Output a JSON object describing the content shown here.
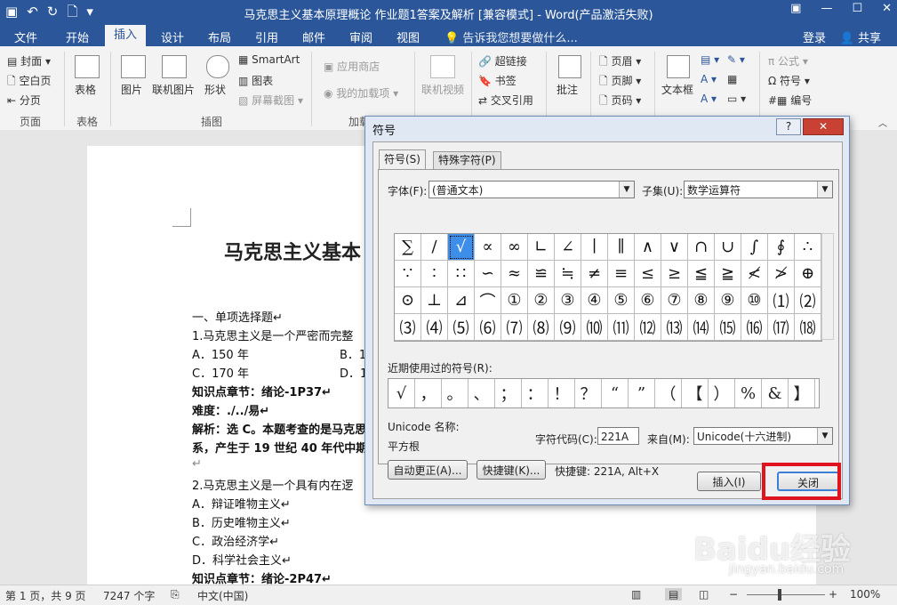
{
  "window": {
    "title": "马克思主义基本原理概论  作业题1答案及解析 [兼容模式] - Word(产品激活失败)",
    "controls": [
      "▣",
      "—",
      "☐",
      "✕"
    ]
  },
  "qat": {
    "save_icon": "▣",
    "undo_icon": "↶",
    "redo_icon": "↻",
    "new_icon": "🗋",
    "more_icon": "▾"
  },
  "ribbon_tabs": [
    "文件",
    "开始",
    "插入",
    "设计",
    "布局",
    "引用",
    "邮件",
    "审阅",
    "视图"
  ],
  "active_tab": "插入",
  "tell_me": "💡 告诉我您想要做什么...",
  "login": "登录",
  "share": "共享",
  "ribbon": {
    "pages": {
      "cover": "封面",
      "blank": "空白页",
      "break": "分页",
      "label": "页面"
    },
    "tables": {
      "table": "表格",
      "label": "表格"
    },
    "illustrations": {
      "picture": "图片",
      "online_picture": "联机图片",
      "shapes": "形状",
      "smartart": "SmartArt",
      "chart": "图表",
      "screenshot": "屏幕截图",
      "label": "插图"
    },
    "addins": {
      "store": "应用商店",
      "my_addins": "我的加载项",
      "label": "加载"
    },
    "media": {
      "online_video": "联机视频"
    },
    "links": {
      "hyperlink": "超链接",
      "bookmark": "书签",
      "crossref": "交叉引用"
    },
    "comments": {
      "comment": "批注"
    },
    "header_footer": {
      "header": "页眉",
      "footer": "页脚",
      "page_number": "页码"
    },
    "text": {
      "textbox": "文本框"
    },
    "symbols": {
      "equation": "公式",
      "symbol": "符号",
      "number": "编号"
    }
  },
  "document": {
    "title": "马克思主义基本",
    "lines": [
      "一、单项选择题↵",
      "1.马克思主义是一个严密而完整",
      "A．150 年",
      "B．1",
      "C．170 年",
      "D．1",
      "知识点章节：绪论-1P37↵",
      "难度：./../易↵",
      "解析：选 C。本题考查的是马克思",
      "系，产生于 19 世纪 40 年代中期",
      "↵",
      "2.马克思主义是一个具有内在逻",
      "A．辩证唯物主义↵",
      "B．历史唯物主义↵",
      "C．政治经济学↵",
      "D．科学社会主义↵",
      "知识点章节：绪论-2P47↵"
    ]
  },
  "dialog": {
    "title": "符号",
    "help": "?",
    "close_x": "✕",
    "tab_symbols": "符号(S)",
    "tab_special": "特殊字符(P)",
    "font_label": "字体(F):",
    "font_value": "(普通文本)",
    "subset_label": "子集(U):",
    "subset_value": "数学运算符",
    "symbols": [
      "∑",
      "∕",
      "√",
      "∝",
      "∞",
      "∟",
      "∠",
      "∣",
      "∥",
      "∧",
      "∨",
      "∩",
      "∪",
      "∫",
      "∮",
      "∴",
      "∵",
      "∶",
      "∷",
      "∽",
      "≈",
      "≌",
      "≒",
      "≠",
      "≡",
      "≤",
      "≥",
      "≦",
      "≧",
      "≮",
      "≯",
      "⊕",
      "⊙",
      "⊥",
      "⊿",
      "⌒",
      "①",
      "②",
      "③",
      "④",
      "⑤",
      "⑥",
      "⑦",
      "⑧",
      "⑨",
      "⑩",
      "⑴",
      "⑵",
      "⑶",
      "⑷",
      "⑸",
      "⑹",
      "⑺",
      "⑻",
      "⑼",
      "⑽",
      "⑾",
      "⑿",
      "⒀",
      "⒁",
      "⒂",
      "⒃",
      "⒄",
      "⒅"
    ],
    "selected_symbol": "√",
    "recent_label": "近期使用过的符号(R):",
    "recent_symbols": [
      "√",
      "，",
      "。",
      "、",
      "；",
      "：",
      "！",
      "？",
      "“",
      "”",
      "（",
      "【",
      "）",
      "%",
      "&",
      "】"
    ],
    "unicode_name_label": "Unicode 名称:",
    "unicode_name": "平方根",
    "charcode_label": "字符代码(C):",
    "charcode": "221A",
    "from_label": "来自(M):",
    "from_value": "Unicode(十六进制)",
    "autocorrect_btn": "自动更正(A)...",
    "shortcut_btn": "快捷键(K)...",
    "shortcut_text": "快捷键: 221A, Alt+X",
    "insert_btn": "插入(I)",
    "close_btn": "关闭"
  },
  "status": {
    "page": "第 1 页，共 9 页",
    "words": "7247 个字",
    "lang": "中文(中国)",
    "zoom": "100%",
    "zoom_minus": "−",
    "zoom_plus": "+"
  },
  "watermark": {
    "text": "Baidu经验",
    "url": "jingyan.baidu.com"
  },
  "colors": {
    "word_blue": "#2b579a",
    "highlight_red": "#e0141e",
    "selection_blue": "#3d8ee8"
  }
}
